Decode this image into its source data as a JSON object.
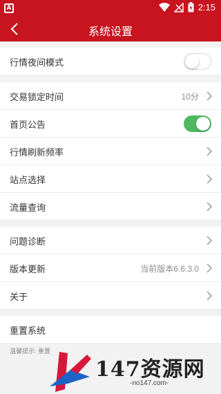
{
  "status_bar": {
    "time": "2:15",
    "app_badge": "A"
  },
  "header": {
    "title": "系统设置"
  },
  "sections": {
    "night_mode": {
      "label": "行情夜间模式",
      "toggle_on": false
    },
    "lock_time": {
      "label": "交易锁定时间",
      "value": "10分"
    },
    "announcement": {
      "label": "首页公告",
      "toggle_on": true
    },
    "refresh_rate": {
      "label": "行情刷新频率"
    },
    "site_select": {
      "label": "站点选择"
    },
    "traffic_query": {
      "label": "流量查询"
    },
    "diagnosis": {
      "label": "问题诊断"
    },
    "update": {
      "label": "版本更新",
      "value": "当前版本6.6.3.0"
    },
    "about": {
      "label": "关于"
    },
    "reset": {
      "label": "重置系统"
    }
  },
  "tip": {
    "text": "温馨提示: 重置"
  },
  "watermark": {
    "brand": "147资源网",
    "url": "-no147.com-"
  },
  "colors": {
    "accent": "#c8141f",
    "toggle_on": "#4cb962"
  }
}
